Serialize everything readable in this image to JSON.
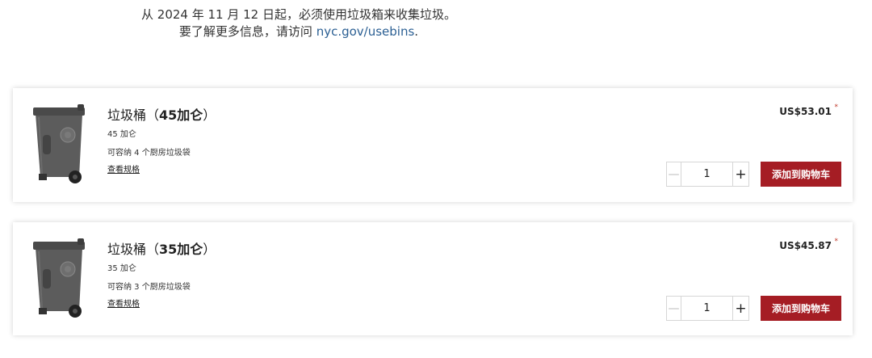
{
  "notice": {
    "line1": "从 2024 年 11 月 12 日起，必须使用垃圾箱来收集垃圾。",
    "line2_prefix": "要了解更多信息，请访问 ",
    "link": "nyc.gov/usebins",
    "line2_suffix": "."
  },
  "products": [
    {
      "title_prefix": "垃圾桶（",
      "title_bold": "45加仑",
      "title_suffix": "）",
      "capacity": "45 加仑",
      "holds": "可容纳 4 个厨房垃圾袋",
      "spec_link": "查看规格",
      "price": "US$53.01",
      "price_mark": "*",
      "qty": "1",
      "add_label": "添加到购物车"
    },
    {
      "title_prefix": "垃圾桶（",
      "title_bold": "35加仑",
      "title_suffix": "）",
      "capacity": "35 加仑",
      "holds": "可容纳 3 个厨房垃圾袋",
      "spec_link": "查看规格",
      "price": "US$45.87",
      "price_mark": "*",
      "qty": "1",
      "add_label": "添加到购物车"
    }
  ],
  "colors": {
    "accent": "#a51d24",
    "link": "#2b5f93",
    "bin": "#5a5a5a"
  }
}
